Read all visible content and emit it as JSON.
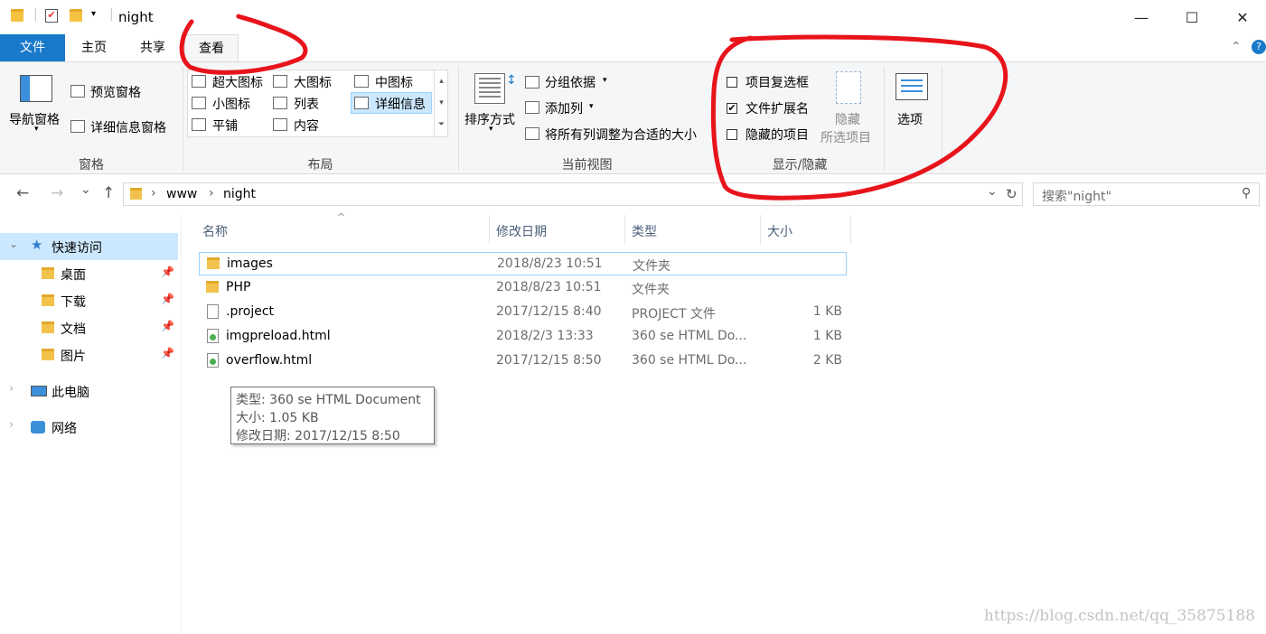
{
  "window": {
    "title": "night",
    "qat_icons": [
      "folder-icon",
      "properties-check-icon",
      "new-folder-icon",
      "dropdown-icon"
    ],
    "controls": [
      "minimize",
      "maximize",
      "close"
    ],
    "control_glyphs": {
      "minimize": "—",
      "maximize": "☐",
      "close": "✕"
    }
  },
  "tabs": [
    {
      "label": "文件"
    },
    {
      "label": "主页"
    },
    {
      "label": "共享"
    },
    {
      "label": "查看"
    }
  ],
  "ribbon": {
    "pane": {
      "nav_pane": "导航窗格",
      "preview_pane": "预览窗格",
      "details_pane": "详细信息窗格",
      "group": "窗格"
    },
    "layout": {
      "items": [
        "超大图标",
        "大图标",
        "中图标",
        "小图标",
        "列表",
        "详细信息",
        "平铺",
        "内容"
      ],
      "selected": "详细信息",
      "group": "布局"
    },
    "current_view": {
      "sort": "排序方式",
      "group_by": "分组依据",
      "add_column": "添加列",
      "fit_columns": "将所有列调整为合适的大小",
      "group": "当前视图"
    },
    "show_hide": {
      "item_checkboxes": {
        "label": "项目复选框",
        "checked": false
      },
      "file_extensions": {
        "label": "文件扩展名",
        "checked": true
      },
      "hidden_items": {
        "label": "隐藏的项目",
        "checked": false
      },
      "hide_selected_line1": "隐藏",
      "hide_selected_line2": "所选项目",
      "group": "显示/隐藏"
    },
    "options": "选项",
    "check_glyph": "✔"
  },
  "address": {
    "path": [
      "www",
      "night"
    ],
    "search_placeholder": "搜索\"night\"",
    "glyphs": {
      "back": "←",
      "forward": "→",
      "recent": "⌄",
      "up": "↑",
      "chevron": "›",
      "dropdown": "⌄",
      "refresh": "↻",
      "search": "⚲"
    }
  },
  "nav": {
    "quick_access": "快速访问",
    "pinned": [
      "桌面",
      "下载",
      "文档",
      "图片"
    ],
    "this_pc": "此电脑",
    "network": "网络",
    "glyphs": {
      "expand": "⌄",
      "collapse": "›",
      "pin": "📌",
      "star": "★"
    }
  },
  "columns": [
    "名称",
    "修改日期",
    "类型",
    "大小"
  ],
  "sort_arrow": "^",
  "files": [
    {
      "name": "images",
      "date": "2018/8/23 10:51",
      "type": "文件夹",
      "size": "",
      "kind": "folder"
    },
    {
      "name": "PHP",
      "date": "2018/8/23 10:51",
      "type": "文件夹",
      "size": "",
      "kind": "folder"
    },
    {
      "name": ".project",
      "date": "2017/12/15 8:40",
      "type": "PROJECT 文件",
      "size": "1 KB",
      "kind": "file"
    },
    {
      "name": "imgpreload.html",
      "date": "2018/2/3 13:33",
      "type": "360 se HTML Do...",
      "size": "1 KB",
      "kind": "html"
    },
    {
      "name": "overflow.html",
      "date": "2017/12/15 8:50",
      "type": "360 se HTML Do...",
      "size": "2 KB",
      "kind": "html"
    }
  ],
  "tooltip": {
    "type": "类型: 360 se HTML Document",
    "size": "大小: 1.05 KB",
    "modified": "修改日期: 2017/12/15 8:50"
  },
  "watermark": "https://blog.csdn.net/qq_35875188",
  "colors": {
    "accent": "#1979ca",
    "annotation": "#e8141b",
    "selected_row_border": "#99d1ff",
    "nav_selected": "#cce8ff"
  }
}
